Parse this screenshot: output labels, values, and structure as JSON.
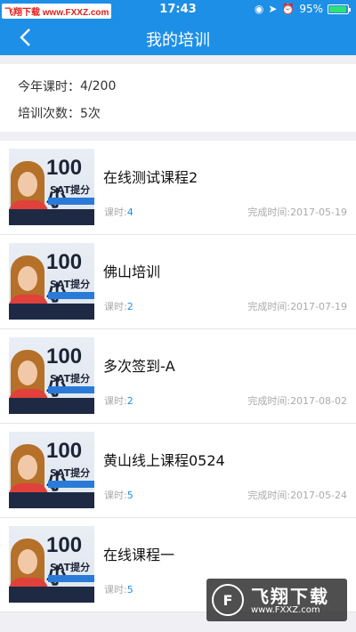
{
  "status_bar": {
    "watermark": "飞翔下载 www.FXXZ.com",
    "time": "17:43",
    "battery_percent": "95%",
    "battery_level": 0.95
  },
  "nav": {
    "title": "我的培训"
  },
  "summary": {
    "year_hours_label": "今年课时：",
    "year_hours_value": "4/200",
    "training_count_label": "培训次数：",
    "training_count_value": "5次"
  },
  "course_thumb": {
    "big_text": "100小",
    "sub_text": "SAT提分3"
  },
  "courses": [
    {
      "title": "在线测试课程2",
      "hours_label": "课时:",
      "hours": "4",
      "date_label": "完成时间:",
      "date": "2017-05-19"
    },
    {
      "title": "佛山培训",
      "hours_label": "课时:",
      "hours": "2",
      "date_label": "完成时间:",
      "date": "2017-07-19"
    },
    {
      "title": "多次签到-A",
      "hours_label": "课时:",
      "hours": "2",
      "date_label": "完成时间:",
      "date": "2017-08-02"
    },
    {
      "title": "黄山线上课程0524",
      "hours_label": "课时:",
      "hours": "5",
      "date_label": "完成时间:",
      "date": "2017-05-24"
    },
    {
      "title": "在线课程一",
      "hours_label": "课时:",
      "hours": "5",
      "date_label": "",
      "date": ""
    }
  ],
  "watermark_bottom": {
    "brand": "飞翔下载",
    "url": "www.FXXZ.com"
  },
  "colors": {
    "primary": "#1e8fe6",
    "background": "#efeff4"
  }
}
